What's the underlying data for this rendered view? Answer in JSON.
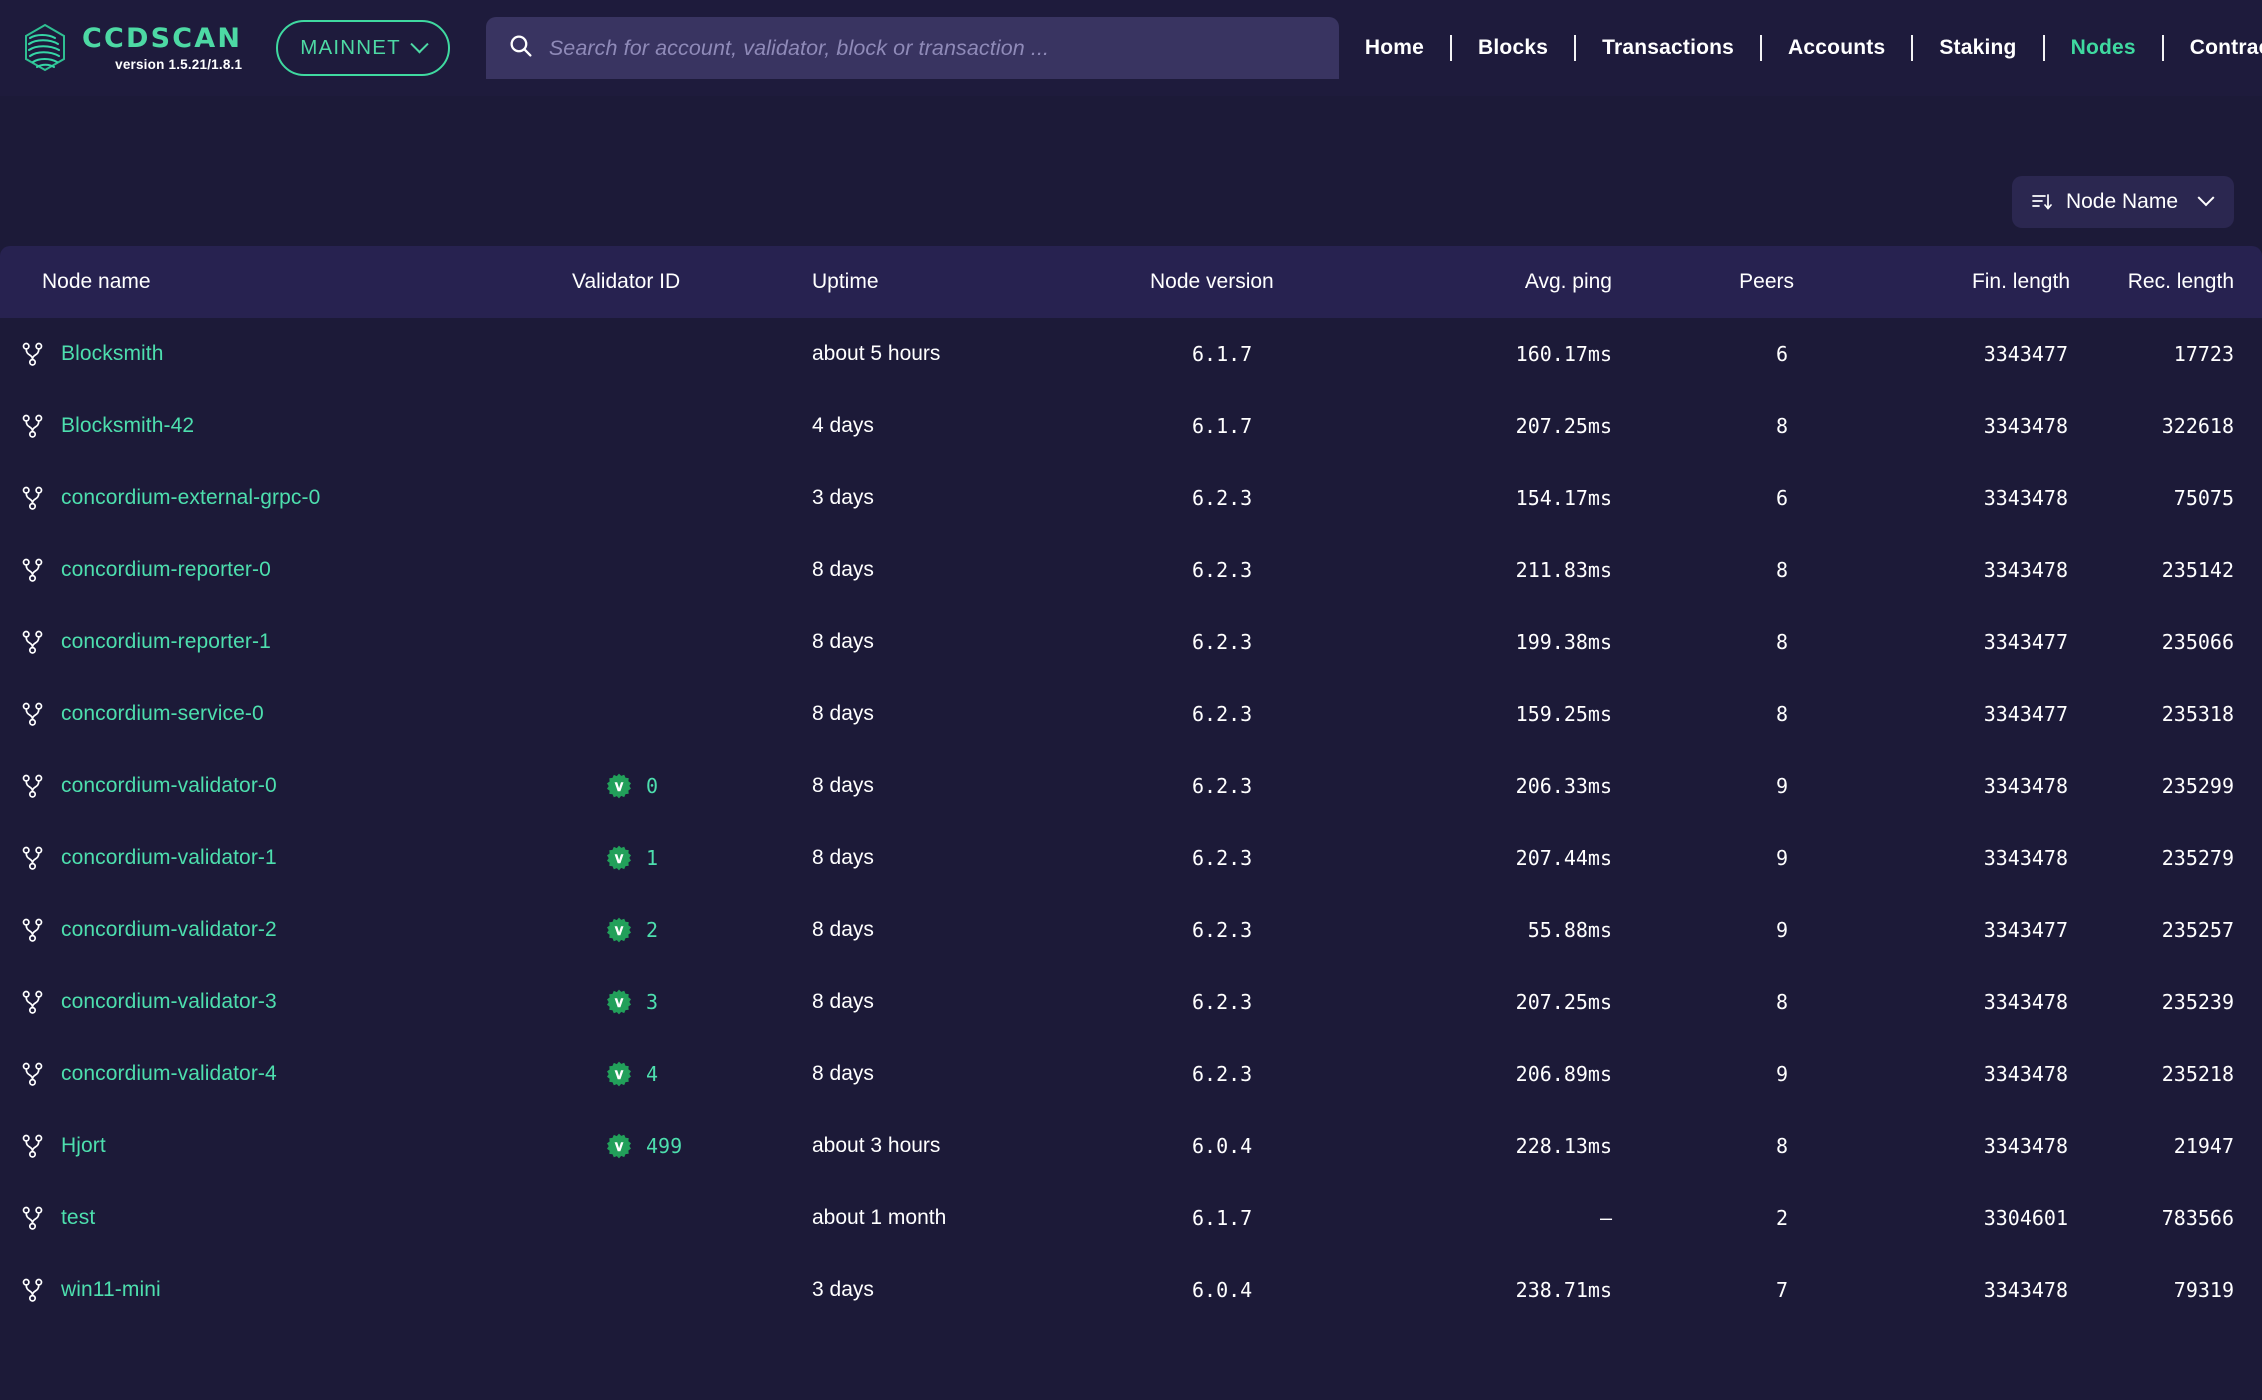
{
  "header": {
    "brand": {
      "name": "CCDSCAN",
      "version": "version 1.5.21/1.8.1",
      "logo_icon": "concordium-logo-icon"
    },
    "network": {
      "label": "MAINNET",
      "chevron_icon": "chevron-down-icon"
    },
    "search": {
      "placeholder": "Search for account, validator, block or transaction ...",
      "value": "",
      "icon": "search-icon"
    },
    "nav": [
      {
        "label": "Home",
        "active": false
      },
      {
        "label": "Blocks",
        "active": false
      },
      {
        "label": "Transactions",
        "active": false
      },
      {
        "label": "Accounts",
        "active": false
      },
      {
        "label": "Staking",
        "active": false
      },
      {
        "label": "Nodes",
        "active": true
      },
      {
        "label": "Contracts",
        "active": false
      }
    ]
  },
  "toolbar": {
    "sort": {
      "label": "Node Name",
      "sort_icon": "sort-descending-icon",
      "chevron_icon": "chevron-down-icon"
    }
  },
  "table": {
    "columns": [
      {
        "key": "node_name",
        "label": "Node name"
      },
      {
        "key": "validator_id",
        "label": "Validator ID"
      },
      {
        "key": "uptime",
        "label": "Uptime"
      },
      {
        "key": "node_version",
        "label": "Node version"
      },
      {
        "key": "avg_ping",
        "label": "Avg. ping"
      },
      {
        "key": "peers",
        "label": "Peers"
      },
      {
        "key": "fin_length",
        "label": "Fin. length"
      },
      {
        "key": "rec_length",
        "label": "Rec. length"
      }
    ],
    "rows": [
      {
        "node_name": "Blocksmith",
        "validator_id": "",
        "uptime": "about 5 hours",
        "node_version": "6.1.7",
        "avg_ping": "160.17ms",
        "peers": "6",
        "fin_length": "3343477",
        "rec_length": "17723"
      },
      {
        "node_name": "Blocksmith-42",
        "validator_id": "",
        "uptime": "4 days",
        "node_version": "6.1.7",
        "avg_ping": "207.25ms",
        "peers": "8",
        "fin_length": "3343478",
        "rec_length": "322618"
      },
      {
        "node_name": "concordium-external-grpc-0",
        "validator_id": "",
        "uptime": "3 days",
        "node_version": "6.2.3",
        "avg_ping": "154.17ms",
        "peers": "6",
        "fin_length": "3343478",
        "rec_length": "75075"
      },
      {
        "node_name": "concordium-reporter-0",
        "validator_id": "",
        "uptime": "8 days",
        "node_version": "6.2.3",
        "avg_ping": "211.83ms",
        "peers": "8",
        "fin_length": "3343478",
        "rec_length": "235142"
      },
      {
        "node_name": "concordium-reporter-1",
        "validator_id": "",
        "uptime": "8 days",
        "node_version": "6.2.3",
        "avg_ping": "199.38ms",
        "peers": "8",
        "fin_length": "3343477",
        "rec_length": "235066"
      },
      {
        "node_name": "concordium-service-0",
        "validator_id": "",
        "uptime": "8 days",
        "node_version": "6.2.3",
        "avg_ping": "159.25ms",
        "peers": "8",
        "fin_length": "3343477",
        "rec_length": "235318"
      },
      {
        "node_name": "concordium-validator-0",
        "validator_id": "0",
        "uptime": "8 days",
        "node_version": "6.2.3",
        "avg_ping": "206.33ms",
        "peers": "9",
        "fin_length": "3343478",
        "rec_length": "235299"
      },
      {
        "node_name": "concordium-validator-1",
        "validator_id": "1",
        "uptime": "8 days",
        "node_version": "6.2.3",
        "avg_ping": "207.44ms",
        "peers": "9",
        "fin_length": "3343478",
        "rec_length": "235279"
      },
      {
        "node_name": "concordium-validator-2",
        "validator_id": "2",
        "uptime": "8 days",
        "node_version": "6.2.3",
        "avg_ping": "55.88ms",
        "peers": "9",
        "fin_length": "3343477",
        "rec_length": "235257"
      },
      {
        "node_name": "concordium-validator-3",
        "validator_id": "3",
        "uptime": "8 days",
        "node_version": "6.2.3",
        "avg_ping": "207.25ms",
        "peers": "8",
        "fin_length": "3343478",
        "rec_length": "235239"
      },
      {
        "node_name": "concordium-validator-4",
        "validator_id": "4",
        "uptime": "8 days",
        "node_version": "6.2.3",
        "avg_ping": "206.89ms",
        "peers": "9",
        "fin_length": "3343478",
        "rec_length": "235218"
      },
      {
        "node_name": "Hjort",
        "validator_id": "499",
        "uptime": "about 3 hours",
        "node_version": "6.0.4",
        "avg_ping": "228.13ms",
        "peers": "8",
        "fin_length": "3343478",
        "rec_length": "21947"
      },
      {
        "node_name": "test",
        "validator_id": "",
        "uptime": "about 1 month",
        "node_version": "6.1.7",
        "avg_ping": "–",
        "peers": "2",
        "fin_length": "3304601",
        "rec_length": "783566"
      },
      {
        "node_name": "win11-mini",
        "validator_id": "",
        "uptime": "3 days",
        "node_version": "6.0.4",
        "avg_ping": "238.71ms",
        "peers": "7",
        "fin_length": "3343478",
        "rec_length": "79319"
      }
    ]
  },
  "colors": {
    "page_bg": "#1c1a38",
    "header_bg": "#1e1b3c",
    "table_header_bg": "#272250",
    "accent_green": "#3fd9a0",
    "link_green": "#4ddfae",
    "badge_green": "#22a05a",
    "search_bg": "#393461"
  }
}
